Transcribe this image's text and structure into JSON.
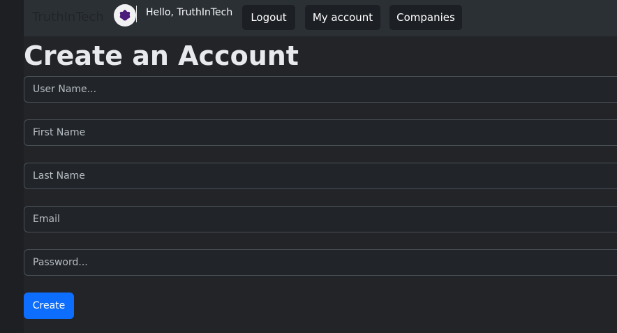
{
  "navbar": {
    "brand": "TruthInTech",
    "greeting": "Hello, TruthInTech",
    "avatar_icon": "purple-blob-icon",
    "buttons": {
      "logout": "Logout",
      "my_account": "My account",
      "companies": "Companies"
    }
  },
  "form": {
    "title": "Create an Account",
    "fields": {
      "username": {
        "placeholder": "User Name...",
        "value": ""
      },
      "first_name": {
        "placeholder": "First Name",
        "value": ""
      },
      "last_name": {
        "placeholder": "Last Name",
        "value": ""
      },
      "email": {
        "placeholder": "Email",
        "value": ""
      },
      "password": {
        "placeholder": "Password...",
        "value": ""
      }
    },
    "submit_label": "Create"
  },
  "colors": {
    "background": "#222428",
    "navbar": "#2b3035",
    "primary": "#0d6efd",
    "avatar_blob": "#4b1c7a"
  }
}
